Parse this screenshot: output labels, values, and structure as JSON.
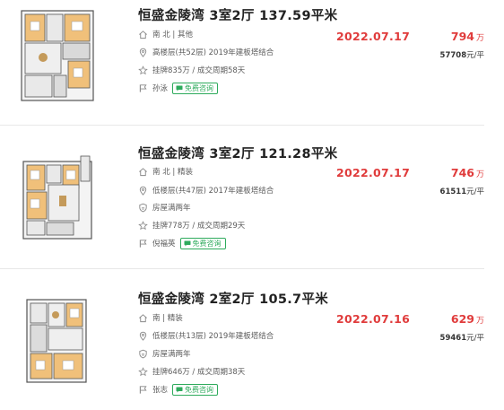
{
  "listings": [
    {
      "title": "恒盛金陵湾 3室2厅 137.59平米",
      "orientation": "南 北 | 其他",
      "floor_info": "高楼层(共52层) 2019年建板塔结合",
      "term_tag": "",
      "stats": "挂牌835万 / 成交周期58天",
      "agent": "孙泳",
      "consult_label": "免费咨询",
      "deal_date": "2022.07.17",
      "total_price": "794",
      "total_price_unit": "万",
      "unit_price": "57708",
      "unit_price_suffix": "元/平"
    },
    {
      "title": "恒盛金陵湾 3室2厅 121.28平米",
      "orientation": "南 北 | 精装",
      "floor_info": "低楼层(共47层) 2017年建板塔结合",
      "term_tag": "房屋满两年",
      "stats": "挂牌778万 / 成交周期29天",
      "agent": "倪福英",
      "consult_label": "免费咨询",
      "deal_date": "2022.07.17",
      "total_price": "746",
      "total_price_unit": "万",
      "unit_price": "61511",
      "unit_price_suffix": "元/平"
    },
    {
      "title": "恒盛金陵湾 2室2厅 105.7平米",
      "orientation": "南 | 精装",
      "floor_info": "低楼层(共13层) 2019年建板塔结合",
      "term_tag": "房屋满两年",
      "stats": "挂牌646万 / 成交周期38天",
      "agent": "张志",
      "consult_label": "免费咨询",
      "deal_date": "2022.07.16",
      "total_price": "629",
      "total_price_unit": "万",
      "unit_price": "59461",
      "unit_price_suffix": "元/平"
    }
  ],
  "colors": {
    "price_red": "#e03c3c",
    "consult_green": "#2eab5c",
    "room_orange": "#f0c07a",
    "room_grey": "#e9e9e9"
  },
  "icons": {
    "orientation": "house-icon",
    "floor": "location-pin-icon",
    "term": "shield-icon",
    "stats": "star-icon",
    "agent": "person-icon",
    "consult": "chat-bubble-icon"
  }
}
